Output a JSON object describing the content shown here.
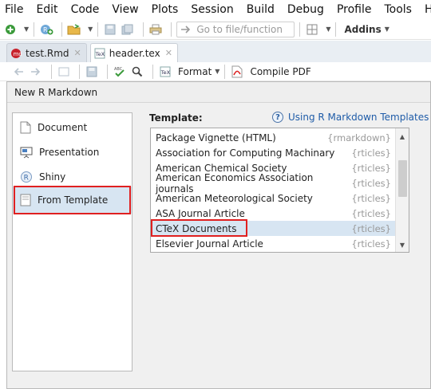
{
  "menu": [
    "File",
    "Edit",
    "Code",
    "View",
    "Plots",
    "Session",
    "Build",
    "Debug",
    "Profile",
    "Tools",
    "Help"
  ],
  "toolbar": {
    "goto_placeholder": "Go to file/function",
    "addins_label": "Addins"
  },
  "tabs": [
    {
      "label": "test.Rmd",
      "active": false
    },
    {
      "label": "header.tex",
      "active": true
    }
  ],
  "editor_toolbar": {
    "format_label": "Format",
    "compile_label": "Compile PDF"
  },
  "dialog": {
    "title": "New R Markdown",
    "left_items": [
      {
        "label": "Document",
        "icon": "document-icon",
        "selected": false
      },
      {
        "label": "Presentation",
        "icon": "presentation-icon",
        "selected": false
      },
      {
        "label": "Shiny",
        "icon": "shiny-icon",
        "selected": false
      },
      {
        "label": "From Template",
        "icon": "template-icon",
        "selected": true
      }
    ],
    "template_label": "Template:",
    "help_link": "Using R Markdown Templates",
    "templates": [
      {
        "name": "Package Vignette (HTML)",
        "pkg": "{rmarkdown}"
      },
      {
        "name": "Association for Computing Machinary",
        "pkg": "{rticles}"
      },
      {
        "name": "American Chemical Society",
        "pkg": "{rticles}"
      },
      {
        "name": "American Economics Association journals",
        "pkg": "{rticles}"
      },
      {
        "name": "American Meteorological Society",
        "pkg": "{rticles}"
      },
      {
        "name": "ASA Journal Article",
        "pkg": "{rticles}"
      },
      {
        "name": "CTeX Documents",
        "pkg": "{rticles}"
      },
      {
        "name": "Elsevier Journal Article",
        "pkg": "{rticles}"
      }
    ],
    "selected_template": "CTeX Documents"
  },
  "colors": {
    "highlight": "#e02020",
    "selection": "#d7e5f2",
    "link": "#1f5ca8"
  }
}
